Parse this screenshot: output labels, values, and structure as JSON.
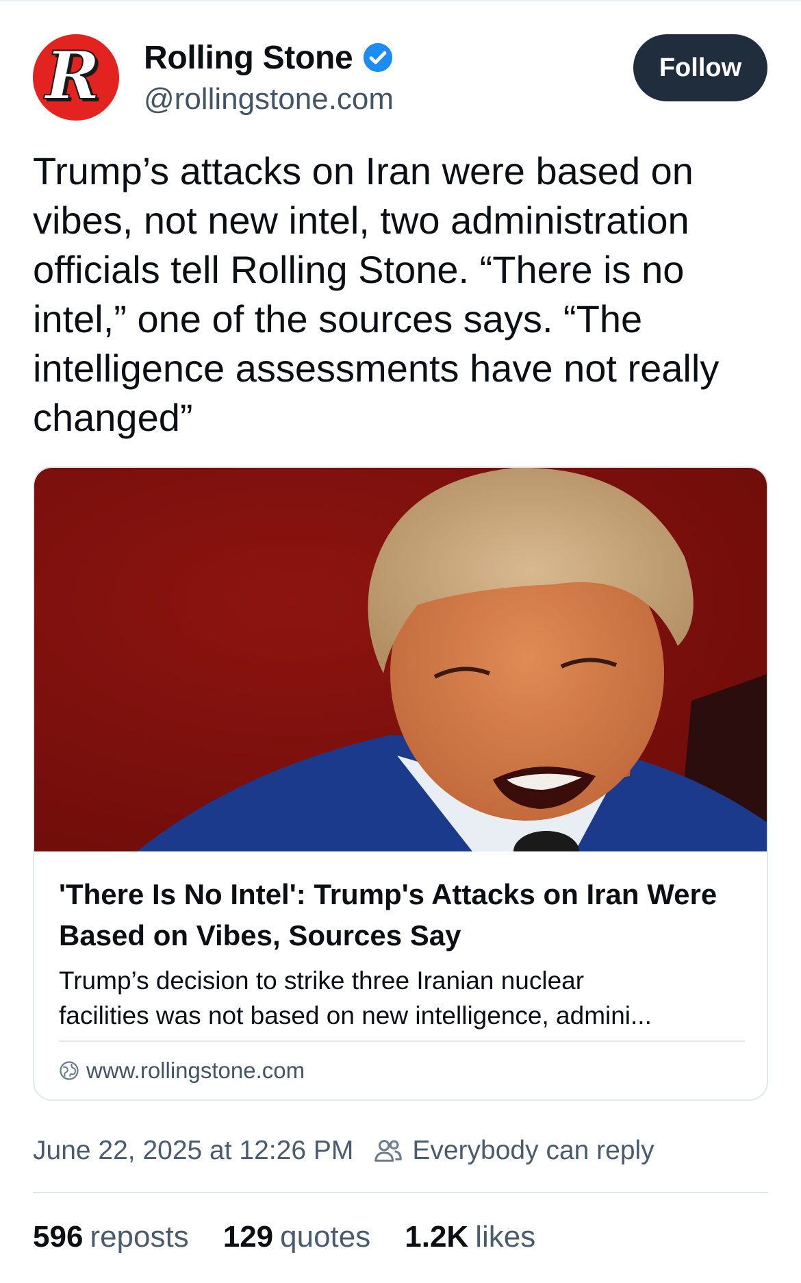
{
  "author": {
    "display_name": "Rolling Stone",
    "handle": "@rollingstone.com",
    "avatar_letter": "R",
    "avatar_color": "#e3231f",
    "verified": true,
    "verified_color": "#1d8cf2"
  },
  "follow_button": {
    "label": "Follow",
    "bg_color": "#1f2d3d"
  },
  "post": {
    "text": "Trump’s attacks on Iran were based on vibes, not new intel, two administration officials tell Rolling Stone. “There is no intel,” one of the sources says. “The intelligence assessments have not really changed”"
  },
  "link_card": {
    "image_icon": "photo-of-man-speaking-at-microphone",
    "title": "'There Is No Intel': Trump's Attacks on Iran Were Based on Vibes, Sources Say",
    "description_line1": "Trump’s decision to strike three Iranian nuclear",
    "description_line2": "facilities was not based on new intelligence, admini...",
    "domain": "www.rollingstone.com"
  },
  "meta": {
    "timestamp": "June 22, 2025 at 12:26 PM",
    "reply_setting": "Everybody can reply"
  },
  "stats": [
    {
      "count": "596",
      "label": "reposts"
    },
    {
      "count": "129",
      "label": "quotes"
    },
    {
      "count": "1.2K",
      "label": "likes"
    }
  ]
}
